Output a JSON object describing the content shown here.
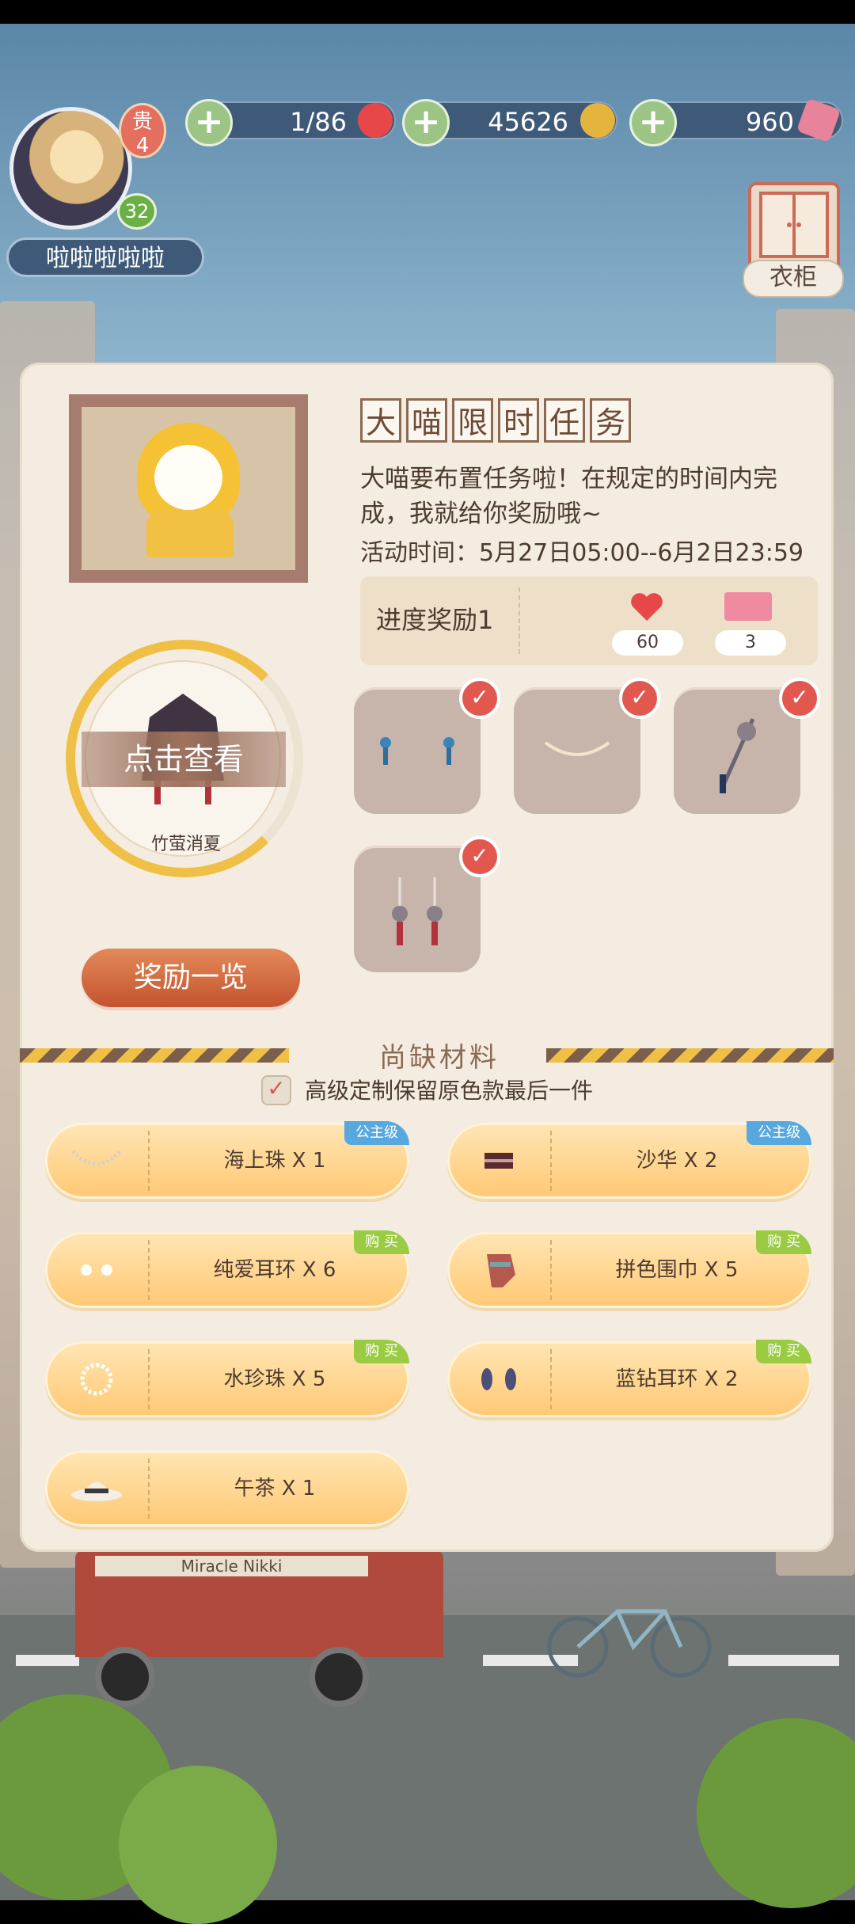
{
  "topbar": {
    "player_name": "啦啦啦啦啦",
    "vip_label": "贵",
    "vip_level": "4",
    "player_level": "32",
    "stamina": "1/86",
    "gold": "45626",
    "diamonds": "960",
    "plus_symbol": "+",
    "wardrobe_label": "衣柜"
  },
  "panel": {
    "title_chars": [
      "大",
      "喵",
      "限",
      "时",
      "任",
      "务"
    ],
    "description": "大喵要布置任务啦！在规定的时间内完成，我就给你奖励哦~",
    "event_time": "活动时间：5月27日05:00--6月2日23:59",
    "progress": {
      "label": "进度奖励1",
      "rewards": [
        {
          "icon": "heart-icon",
          "count": "60",
          "color": "#e8474a"
        },
        {
          "icon": "ticket-icon",
          "count": "3",
          "color": "#f08aa0"
        }
      ]
    },
    "items": [
      {
        "name": "earrings-blue",
        "checked": true
      },
      {
        "name": "necklace",
        "checked": true
      },
      {
        "name": "hairpin",
        "checked": true
      },
      {
        "name": "earrings-red",
        "checked": true
      }
    ],
    "outfit": {
      "view_label": "点击查看",
      "name": "竹萤消夏",
      "progress_fraction": 0.8
    },
    "reward_list_button": "奖励一览",
    "lacking_title": "尚缺材料",
    "keep_original_label": "高级定制保留原色款最后一件",
    "materials": [
      {
        "label": "海上珠 X 1",
        "tag": "公主级",
        "tag_color": "blue",
        "icon": "pearl-necklace-icon"
      },
      {
        "label": "沙华 X 2",
        "tag": "公主级",
        "tag_color": "blue",
        "icon": "fabric-icon"
      },
      {
        "label": "纯爱耳环 X 6",
        "tag": "购 买",
        "tag_color": "green",
        "icon": "earring-icon"
      },
      {
        "label": "拼色围巾 X 5",
        "tag": "购 买",
        "tag_color": "green",
        "icon": "scarf-icon"
      },
      {
        "label": "水珍珠 X 5",
        "tag": "购 买",
        "tag_color": "green",
        "icon": "bracelet-icon"
      },
      {
        "label": "蓝钻耳环 X 2",
        "tag": "购 买",
        "tag_color": "green",
        "icon": "drop-earring-icon"
      },
      {
        "label": "午茶 X 1",
        "tag": "",
        "tag_color": "",
        "icon": "hat-icon"
      }
    ]
  },
  "scene": {
    "bus_sign": "Miracle Nikki"
  },
  "colors": {
    "accent_orange": "#c4532e",
    "gold": "#f0c046",
    "check_red": "#e2584e"
  }
}
